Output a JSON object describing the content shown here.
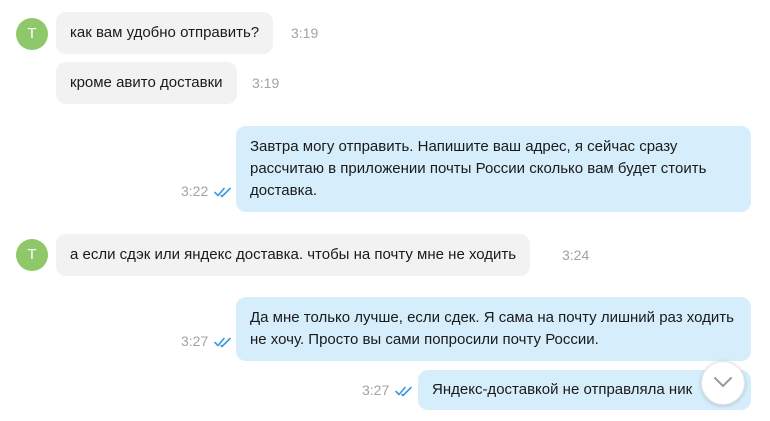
{
  "avatar_letter": "T",
  "messages": [
    {
      "text": "как вам удобно отправить?",
      "time": "3:19"
    },
    {
      "text": "кроме авито доставки",
      "time": "3:19"
    },
    {
      "text": "Завтра могу отправить. Напишите ваш адрес, я сейчас сразу рассчитаю в приложении почты России сколько вам будет стоить доставка.",
      "time": "3:22"
    },
    {
      "text": "а если сдэк или яндекс доставка. чтобы на почту мне не ходить",
      "time": "3:24"
    },
    {
      "text": "Да мне только лучше, если сдек. Я сама на почту лишний раз ходить не хочу. Просто вы сами попросили почту России.",
      "time": "3:27"
    },
    {
      "text": "Яндекс-доставкой не отправляла ник",
      "time": "3:27"
    }
  ],
  "icons": {
    "read_receipt": "double-check-icon",
    "scroll_down": "chevron-down-icon"
  },
  "colors": {
    "avatar": "#8fc86a",
    "incoming_bubble": "#f2f2f2",
    "outgoing_bubble": "#d6eefb",
    "read_check": "#3a9bdc",
    "time": "#a3a3a3"
  }
}
